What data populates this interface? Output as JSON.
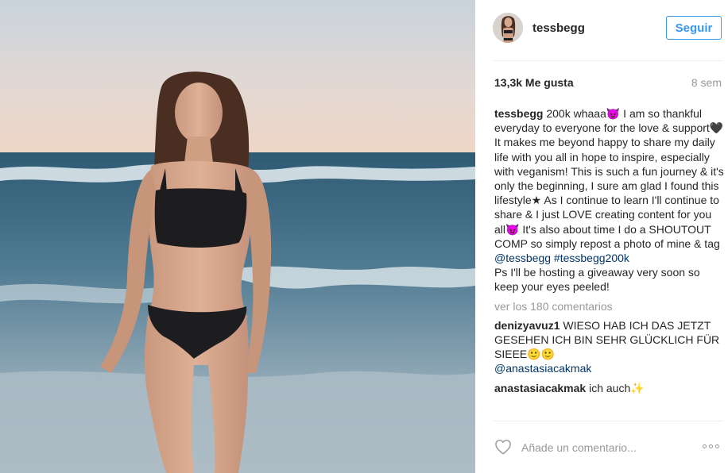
{
  "post": {
    "username": "tessbegg",
    "follow_label": "Seguir",
    "likes": "13,3k Me gusta",
    "time_ago": "8 sem"
  },
  "caption": {
    "username": "tessbegg",
    "text_before_tags": "200k whaaa😈 I am so thankful everyday to everyone for the love & support🖤 It makes me beyond happy to share my daily life with you all in hope to inspire, especially with veganism! This is such a fun journey & it's only the beginning, I sure am glad I found this lifestyle★ As I continue to learn I'll continue to share & I just LOVE creating content for you all😈 It's also about time I do a SHOUTOUT COMP so simply repost a photo of mine & tag",
    "tags": "@tessbegg #tessbegg200k",
    "text_after_tags": "Ps I'll be hosting a giveaway very soon so keep your eyes peeled!"
  },
  "view_more": "ver los 180 comentarios",
  "comments": [
    {
      "username": "denizyavuz1",
      "text": "WIESO HAB ICH DAS JETZT GESEHEN ICH BIN SEHR GLÜCKLICH FÜR SIEEE🙂🙂",
      "mention": "@anastasiacakmak"
    },
    {
      "username": "anastasiacakmak",
      "text": "ich auch✨"
    }
  ],
  "footer": {
    "comment_placeholder": "Añade un comentario...",
    "like_icon": "heart-outline-icon",
    "more_icon": "more-options-icon"
  },
  "colors": {
    "accent": "#3897f0",
    "link": "#003569",
    "muted": "#999999"
  }
}
